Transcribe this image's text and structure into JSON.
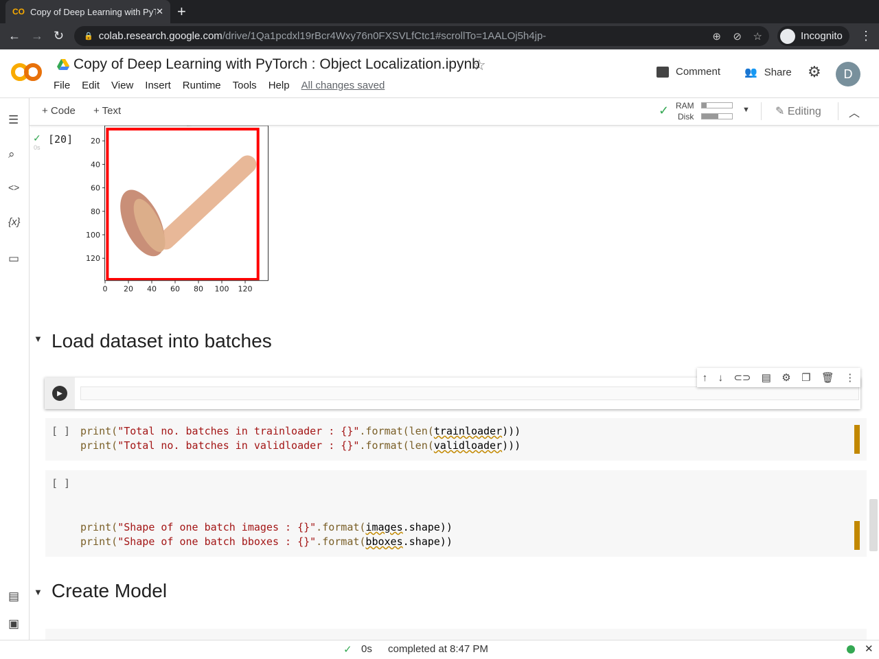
{
  "browser": {
    "tab_title": "Copy of Deep Learning with PyTorch : Object Localization.ipynb",
    "url_host": "colab.research.google.com",
    "url_path": "/drive/1Qa1pcdxl19rBcr4Wxy76n0FXSVLfCtc1#scrollTo=1AALOj5h4jp-",
    "incognito_label": "Incognito"
  },
  "header": {
    "title": "Copy of Deep Learning with PyTorch : Object Localization.ipynb",
    "menu": [
      "File",
      "Edit",
      "View",
      "Insert",
      "Runtime",
      "Tools",
      "Help"
    ],
    "saved": "All changes saved",
    "comment": "Comment",
    "share": "Share",
    "avatar": "D"
  },
  "toolbar": {
    "code": "+ Code",
    "text": "+ Text",
    "ram": "RAM",
    "disk": "Disk",
    "ram_usage": 0.15,
    "disk_usage": 0.55,
    "editing": "Editing"
  },
  "output_cell": {
    "exec_count": "[20]",
    "time": "0s",
    "plot": {
      "x_ticks": [
        "0",
        "20",
        "40",
        "60",
        "80",
        "100",
        "120"
      ],
      "y_ticks": [
        "20",
        "40",
        "60",
        "80",
        "100",
        "120"
      ],
      "bbox_color": "#ff0000"
    }
  },
  "sections": [
    {
      "title": "Load dataset into batches"
    },
    {
      "title": "Create Model"
    }
  ],
  "cells": [
    {
      "prompt": "[ ]",
      "lines": [
        [
          "print(",
          "\"Total no. batches in trainloader : {}\"",
          ".format(",
          "len(",
          "trainloader",
          ")))"
        ],
        [
          "print(",
          "\"Total no. batches in validloader : {}\"",
          ".format(",
          "len(",
          "validloader",
          ")))"
        ]
      ]
    },
    {
      "prompt": "[ ]",
      "lines": [
        [
          "print(",
          "\"Shape of one batch images : {}\"",
          ".format(",
          "images",
          ".shape))"
        ],
        [
          "print(",
          "\"Shape of one batch bboxes : {}\"",
          ".format(",
          "bboxes",
          ".shape))"
        ]
      ]
    }
  ],
  "status": {
    "time": "0s",
    "text": "completed at 8:47 PM"
  },
  "colors": {
    "accent": "#f9ab00",
    "success": "#34a853"
  }
}
